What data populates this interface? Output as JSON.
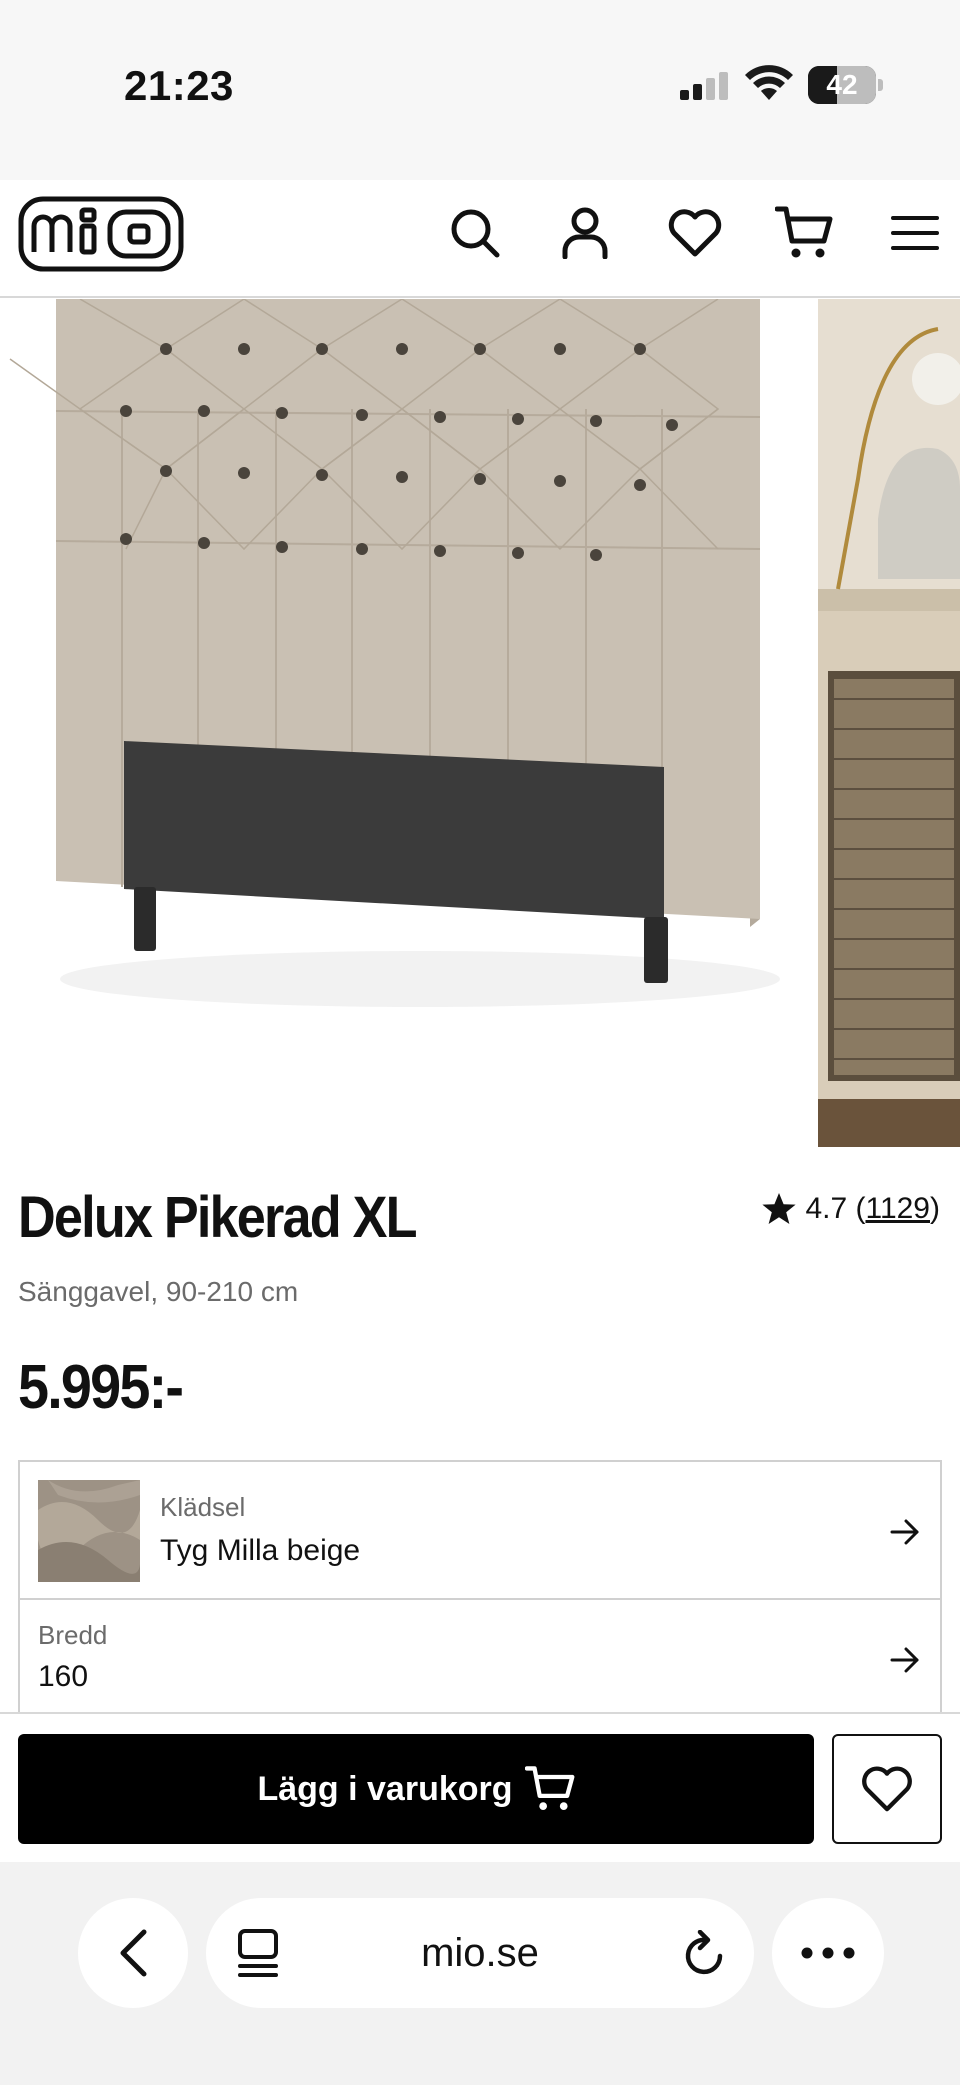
{
  "status_bar": {
    "time": "21:23",
    "battery_level": "42",
    "battery_fraction": 0.42
  },
  "header": {
    "logo_text": "mio",
    "icons": [
      "search-icon",
      "account-icon",
      "heart-icon",
      "cart-icon",
      "menu-icon"
    ]
  },
  "product": {
    "title": "Delux Pikerad XL",
    "subtitle": "Sänggavel, 90-210 cm",
    "price": "5.995:-",
    "rating_value": "4.7",
    "rating_open": " (",
    "rating_count": "1129",
    "rating_close": ")"
  },
  "options": [
    {
      "label": "Klädsel",
      "value": "Tyg Milla beige"
    },
    {
      "label": "Bredd",
      "value": "160"
    }
  ],
  "actions": {
    "add_to_cart_label": "Lägg i varukorg"
  },
  "browser": {
    "address": "mio.se"
  },
  "colors": {
    "accent": "#000000",
    "headboard_fabric": "#c9c0b3",
    "headboard_panel": "#3b3b3b"
  }
}
